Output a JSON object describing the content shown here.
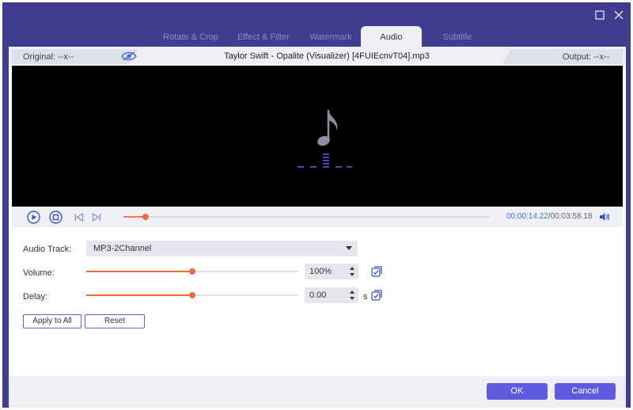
{
  "tabs": [
    {
      "label": "Rotate & Crop",
      "active": false
    },
    {
      "label": "Effect & Filter",
      "active": false
    },
    {
      "label": "Watermark",
      "active": false
    },
    {
      "label": "Audio",
      "active": true
    },
    {
      "label": "Subtitle",
      "active": false
    }
  ],
  "file_info": {
    "original_label": "Original: --x--",
    "file_name": "Taylor Swift - Opalite (Visualizer) [4FUIEcnvT04].mp3",
    "output_label": "Output: --x--"
  },
  "player": {
    "current_time": "00:00:14.22",
    "total_time": "/00:03:58.18",
    "progress_fraction": 0.0596
  },
  "audio_settings": {
    "audio_track_label": "Audio Track:",
    "audio_track_value": "MP3-2Channel",
    "volume_label": "Volume:",
    "volume_value": "100%",
    "volume_slider_fraction": 0.5,
    "delay_label": "Delay:",
    "delay_value": "0.00",
    "delay_unit": "s",
    "delay_slider_fraction": 0.5
  },
  "buttons": {
    "apply_to_all": "Apply to All",
    "reset": "Reset",
    "ok": "OK",
    "cancel": "Cancel"
  },
  "colors": {
    "window_frame": "#403c8f",
    "accent_orange": "#ef6a3c",
    "button_purple": "#5f5bdf",
    "time_blue": "#4a6fd7"
  }
}
